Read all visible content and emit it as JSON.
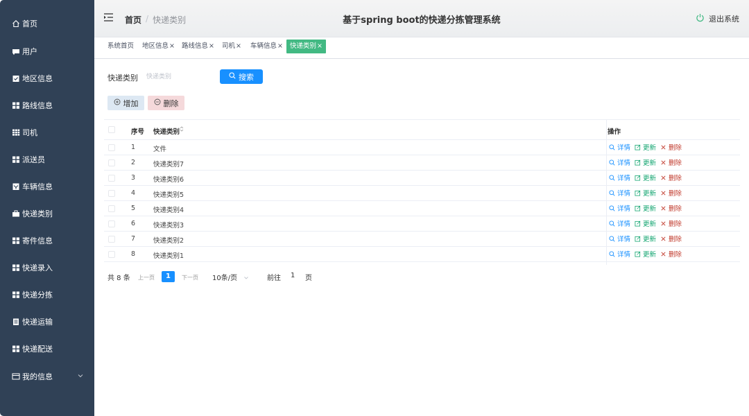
{
  "sidebar": {
    "items": [
      {
        "label": "首页",
        "icon": "home-icon"
      },
      {
        "label": "用户",
        "icon": "user-icon"
      },
      {
        "label": "地区信息",
        "icon": "clipboard-icon"
      },
      {
        "label": "路线信息",
        "icon": "grid-icon"
      },
      {
        "label": "司机",
        "icon": "list-grid-icon"
      },
      {
        "label": "派送员",
        "icon": "grid-icon"
      },
      {
        "label": "车辆信息",
        "icon": "car-icon"
      },
      {
        "label": "快递类别",
        "icon": "briefcase-icon"
      },
      {
        "label": "寄件信息",
        "icon": "grid-icon"
      },
      {
        "label": "快递录入",
        "icon": "grid-icon"
      },
      {
        "label": "快递分拣",
        "icon": "grid-icon"
      },
      {
        "label": "快递运输",
        "icon": "document-icon"
      },
      {
        "label": "快递配送",
        "icon": "grid-icon"
      },
      {
        "label": "我的信息",
        "icon": "id-card-icon"
      }
    ]
  },
  "header": {
    "breadcrumb_home": "首页",
    "breadcrumb_separator": "/",
    "breadcrumb_current": "快递类别",
    "title": "基于spring boot的快递分拣管理系统",
    "logout_label": "退出系统"
  },
  "tabs": [
    {
      "label": "系统首页",
      "closable": false
    },
    {
      "label": "地区信息",
      "closable": true
    },
    {
      "label": "路线信息",
      "closable": true
    },
    {
      "label": "司机",
      "closable": true
    },
    {
      "label": "车辆信息",
      "closable": true
    },
    {
      "label": "快递类别",
      "closable": true,
      "active": true
    }
  ],
  "tab_close_glyph": "×",
  "search": {
    "label": "快递类别",
    "placeholder": "快递类别",
    "button_label": "搜索"
  },
  "actions": {
    "add_label": "增加",
    "delete_label": "删除"
  },
  "table": {
    "headers": {
      "index": "序号",
      "category": "快递类别",
      "ops": "操作"
    },
    "rows": [
      {
        "index": "1",
        "category": "文件"
      },
      {
        "index": "2",
        "category": "快递类别7"
      },
      {
        "index": "3",
        "category": "快递类别6"
      },
      {
        "index": "4",
        "category": "快递类别5"
      },
      {
        "index": "5",
        "category": "快递类别4"
      },
      {
        "index": "6",
        "category": "快递类别3"
      },
      {
        "index": "7",
        "category": "快递类别2"
      },
      {
        "index": "8",
        "category": "快递类别1"
      }
    ],
    "op_labels": {
      "detail": "详情",
      "update": "更新",
      "delete": "删除"
    }
  },
  "pagination": {
    "total": "共 8 条",
    "prev": "上一页",
    "current": "1",
    "next": "下一页",
    "page_size": "10条/页",
    "goto_prefix": "前往",
    "goto_value": "1",
    "goto_suffix": "页"
  },
  "colors": {
    "sidebar_bg": "#304156",
    "primary": "#1890ff",
    "active_tab": "#42b983",
    "update_green": "#13a570",
    "delete_red": "#c0392b"
  }
}
